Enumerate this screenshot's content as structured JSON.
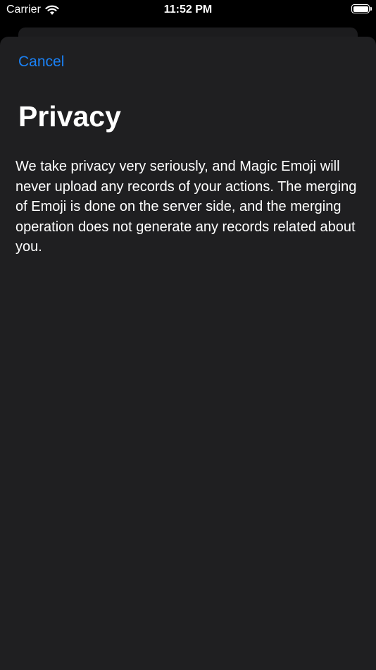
{
  "status_bar": {
    "carrier": "Carrier",
    "time": "11:52 PM"
  },
  "sheet": {
    "cancel_label": "Cancel",
    "title": "Privacy",
    "body": "We take privacy very seriously, and Magic Emoji will never upload any records of your actions.  The merging of Emoji is done on the server side, and the merging operation does not generate any records related about you."
  },
  "colors": {
    "background": "#000000",
    "sheet": "#1f1f21",
    "accent": "#1a82f7",
    "text": "#ffffff"
  },
  "icons": [
    "wifi-icon",
    "battery-icon"
  ]
}
